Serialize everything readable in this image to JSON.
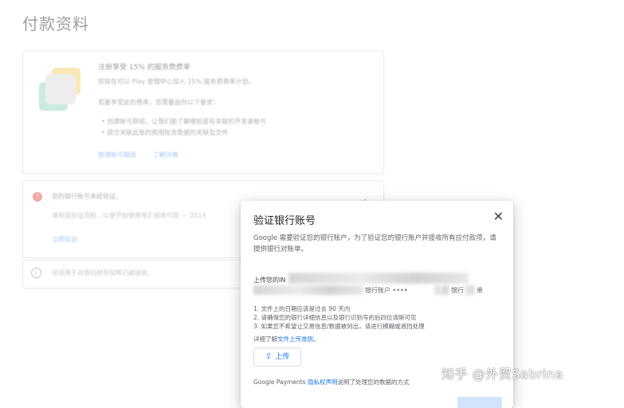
{
  "page": {
    "title": "付款资料"
  },
  "service_fee_card": {
    "title": "注册享受 15% 的服务费费率",
    "line1": "您现在可以 Play 管理中心加入 15% 服务费费率计划。",
    "line2": "若要享受此的费率，您需要由你以下要求：",
    "bullets": [
      "创建帐号群组，让我们能了解哪些是有关联的开发者帐号",
      "提交关联此账的费用账务数据的关联及文件"
    ],
    "links": [
      "管理帐号群组",
      "了解详情"
    ]
  },
  "verify_card": {
    "title": "您的银行账号未经验证。",
    "subtitle": "请完成验证流程，以便开始使用电汇接收付款 — 2019",
    "link": "立即验证"
  },
  "info_card": {
    "text": "您适用于对等的税务保障已被接收。"
  },
  "dialog": {
    "title": "验证银行账号",
    "close_glyph": "✕",
    "description": "Google 需要验证您的银行账户，为了验证您的银行账户并接收所有应付款项，请提供银行对账单。",
    "upload_lead": "上传您的IN",
    "account_label": "银行账户 ••••",
    "account_suffix1": "银行",
    "account_suffix2": "单",
    "rules": [
      "1. 文件上的日期应该是过去 90 天内",
      "2. 请确保您的银行详细信息以及银行识别号的后四位清晰可见",
      "3. 如果您不希望让交易信息/数据被列出，请进行模糊或遮挡处理"
    ],
    "more_prefix": "详细了解",
    "more_link": "文件上传准则",
    "more_suffix": "。",
    "upload_button": "上传",
    "footer_prefix": "Google Payments ",
    "footer_link": "隐私权声明",
    "footer_suffix": "说明了处理您的数据的方式"
  },
  "watermark": "知乎 @外贸Sabrina",
  "colors": {
    "accent": "#1a73e8",
    "title_gray": "#9aa0a6",
    "warning": "#f2a8a0"
  }
}
